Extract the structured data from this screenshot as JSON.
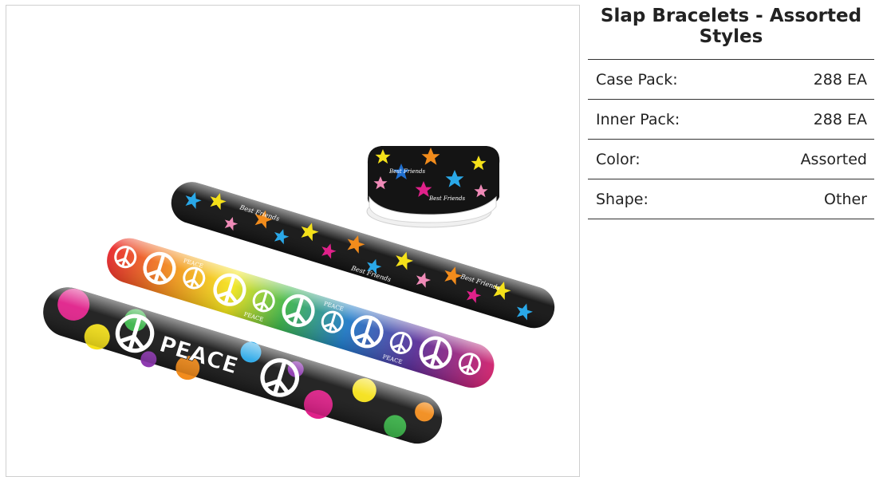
{
  "product": {
    "title": "Slap Bracelets - Assorted Styles",
    "image_alt": "Slap bracelets in star, rainbow peace and psychedelic peace designs"
  },
  "specs": [
    {
      "label": "Case Pack:",
      "value": "288 EA"
    },
    {
      "label": "Inner Pack:",
      "value": "288 EA"
    },
    {
      "label": "Color:",
      "value": "Assorted"
    },
    {
      "label": "Shape:",
      "value": "Other"
    }
  ],
  "bracelets": {
    "star_text": "Best Friends",
    "peace_small": "PEACE",
    "peace_big": "PEACE"
  },
  "colors": {
    "border": "#333333",
    "frame_border": "#cfcfcf",
    "black_band": "#111111",
    "star_yellow": "#f5e11a",
    "star_blue": "#2aa8e8",
    "star_pink": "#f08bb8",
    "star_orange": "#f28c1c",
    "magenta": "#e0218a"
  }
}
